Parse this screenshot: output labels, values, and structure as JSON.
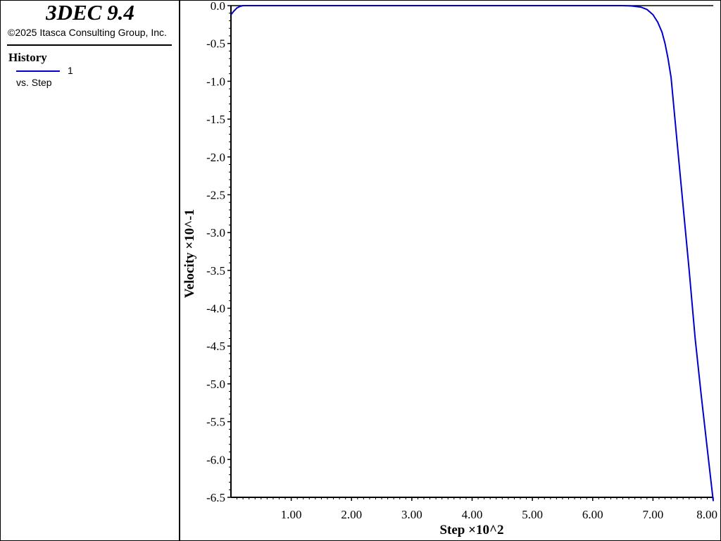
{
  "app": {
    "title": "3DEC 9.4",
    "copyright": "©2025 Itasca Consulting Group, Inc."
  },
  "legend": {
    "title": "History",
    "series_label": "1",
    "subtitle": "vs. Step"
  },
  "colors": {
    "series": "#0000cc",
    "axis": "#000000"
  },
  "chart_data": {
    "type": "line",
    "xlabel": "Step ×10^2",
    "ylabel": "Velocity ×10^-1",
    "xlim": [
      0.0,
      8.0
    ],
    "ylim": [
      -6.5,
      0.0
    ],
    "xticks": [
      "1.00",
      "2.00",
      "3.00",
      "4.00",
      "5.00",
      "6.00",
      "7.00",
      "8.00"
    ],
    "yticks": [
      "0.0",
      "-0.5",
      "-1.0",
      "-1.5",
      "-2.0",
      "-2.5",
      "-3.0",
      "-3.5",
      "-4.0",
      "-4.5",
      "-5.0",
      "-5.5",
      "-6.0",
      "-6.5"
    ],
    "grid": false,
    "series": [
      {
        "name": "1",
        "x": [
          0.0,
          0.05,
          0.1,
          0.15,
          0.2,
          1.0,
          3.0,
          6.0,
          6.5,
          6.65,
          6.8,
          6.9,
          7.0,
          7.08,
          7.15,
          7.2,
          7.25,
          7.3,
          7.4,
          7.5,
          7.6,
          7.7,
          7.8,
          7.9,
          8.0
        ],
        "y": [
          -0.12,
          -0.07,
          -0.03,
          -0.01,
          0.0,
          0.0,
          0.0,
          0.0,
          0.0,
          -0.005,
          -0.02,
          -0.05,
          -0.12,
          -0.22,
          -0.35,
          -0.5,
          -0.7,
          -0.95,
          -1.8,
          -2.65,
          -3.5,
          -4.4,
          -5.15,
          -5.85,
          -6.55
        ]
      }
    ]
  }
}
